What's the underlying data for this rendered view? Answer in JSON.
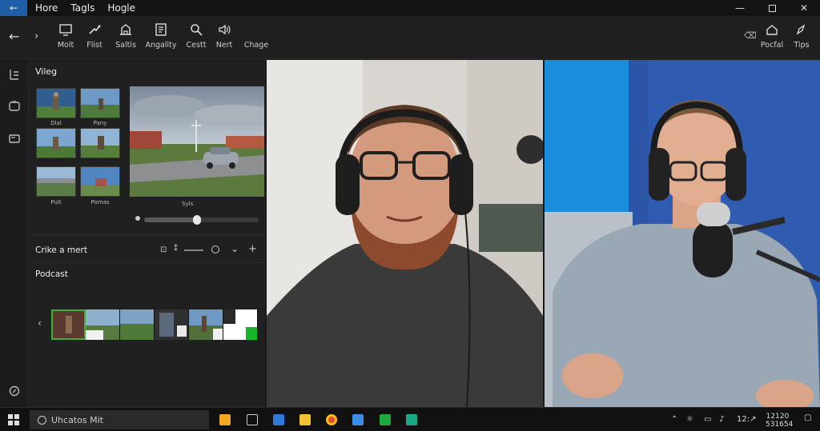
{
  "titlebar": {
    "tabs": [
      "Hore",
      "Tagls",
      "Hogle"
    ]
  },
  "toolbar": {
    "tools": [
      {
        "label": "Molt",
        "icon": "screen-icon"
      },
      {
        "label": "Flist",
        "icon": "pen-icon"
      },
      {
        "label": "Saltis",
        "icon": "building-icon"
      },
      {
        "label": "Angality",
        "icon": "document-icon"
      },
      {
        "label": "Cestt",
        "icon": "magnifier-icon"
      },
      {
        "label": "Nert",
        "icon": "audio-icon"
      },
      {
        "label": "Chage",
        "icon": "blank-icon"
      }
    ],
    "right_tools": [
      {
        "label": "Pocfal",
        "icon": "home-icon"
      },
      {
        "label": "Tips",
        "icon": "pencil-icon"
      }
    ]
  },
  "left_panel": {
    "video_title": "Vileg",
    "thumbs": [
      {
        "caption": "Dlal"
      },
      {
        "caption": "Pany"
      },
      {
        "caption": ""
      },
      {
        "caption": ""
      },
      {
        "caption": "Pult"
      },
      {
        "caption": "Pomas"
      }
    ],
    "preview_caption": "Syls",
    "scrubber_progress": 0.46,
    "row_label": "Crike a mert",
    "podcast_title": "Podcast"
  },
  "taskbar": {
    "search_text": "Uhcatos Mit",
    "tray_time": "12:↗",
    "clock_line1": "12120",
    "clock_line2": "531654"
  },
  "colors": {
    "accent": "#1f5fa8",
    "green": "#3fae3f"
  }
}
